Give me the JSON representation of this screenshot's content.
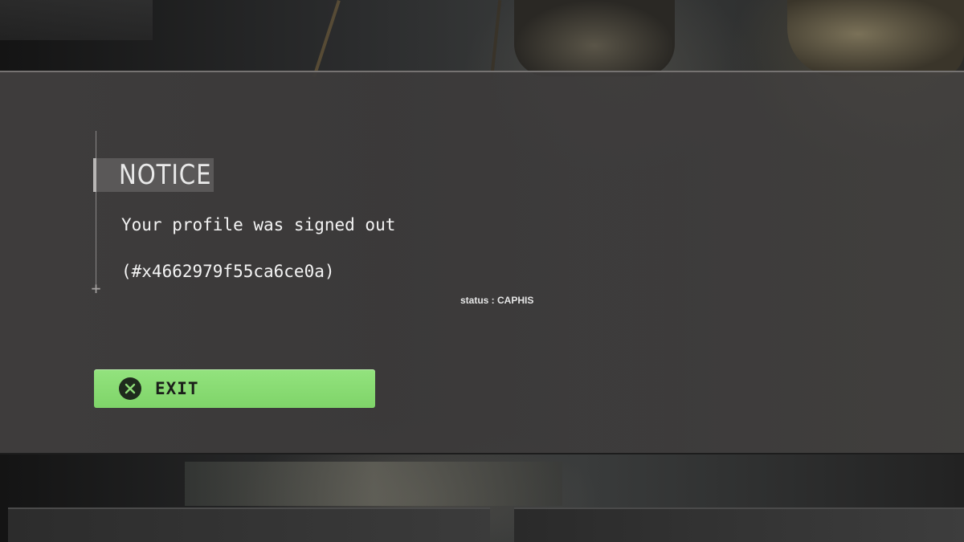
{
  "notice": {
    "title": "NOTICE",
    "message": "Your profile was signed out",
    "error_code": "(#x4662979f55ca6ce0a)",
    "status": "status : CAPHIS"
  },
  "exit_button": {
    "label": "EXIT",
    "icon": "cross-button-icon",
    "color": "#8ddb77"
  },
  "colors": {
    "modal_band": "#403e3e",
    "notice_tag": "#5a5858",
    "text": "#f4f4f4"
  }
}
